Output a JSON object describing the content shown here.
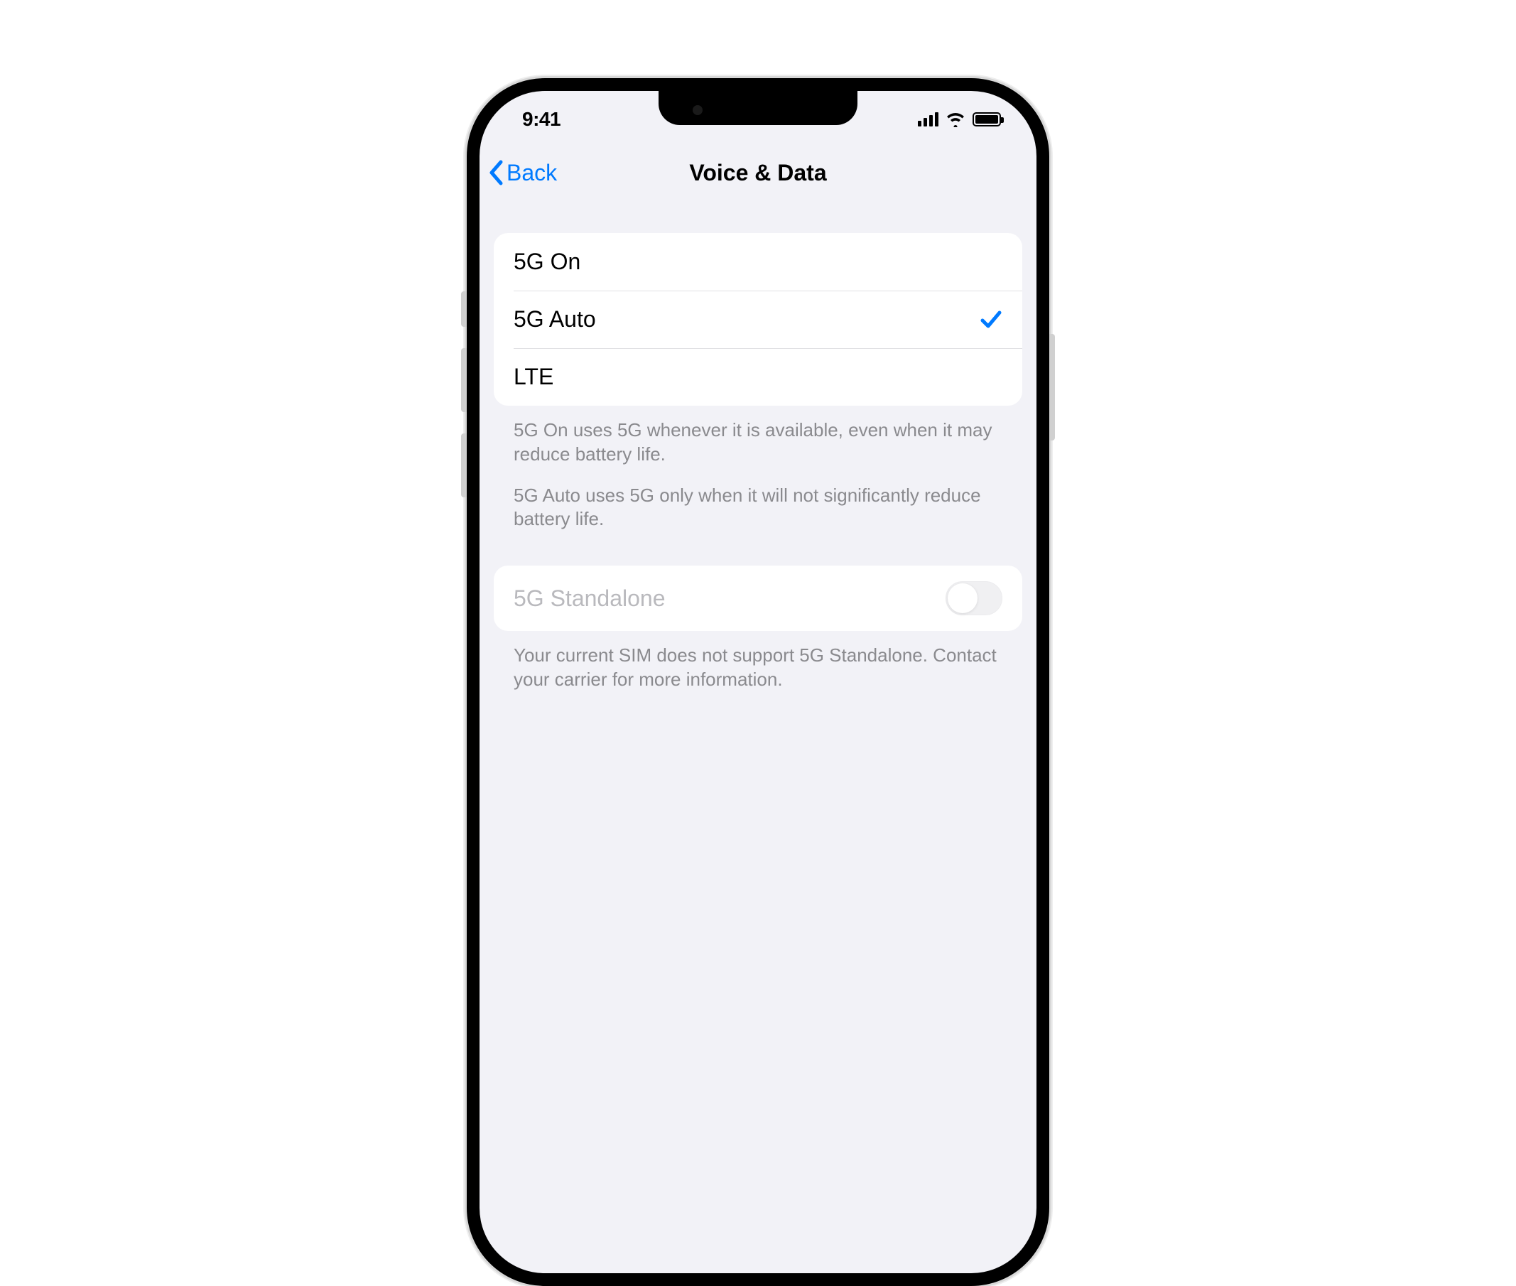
{
  "status_bar": {
    "time": "9:41"
  },
  "nav": {
    "back_label": "Back",
    "title": "Voice & Data"
  },
  "network_options": {
    "selected_index": 1,
    "items": [
      {
        "label": "5G On"
      },
      {
        "label": "5G Auto"
      },
      {
        "label": "LTE"
      }
    ],
    "footer_p1": "5G On uses 5G whenever it is available, even when it may reduce battery life.",
    "footer_p2": "5G Auto uses 5G only when it will not significantly reduce battery life."
  },
  "standalone": {
    "label": "5G Standalone",
    "enabled": false,
    "footer": "Your current SIM does not support 5G Standalone. Contact your carrier for more information."
  },
  "colors": {
    "ios_blue": "#007aff"
  }
}
